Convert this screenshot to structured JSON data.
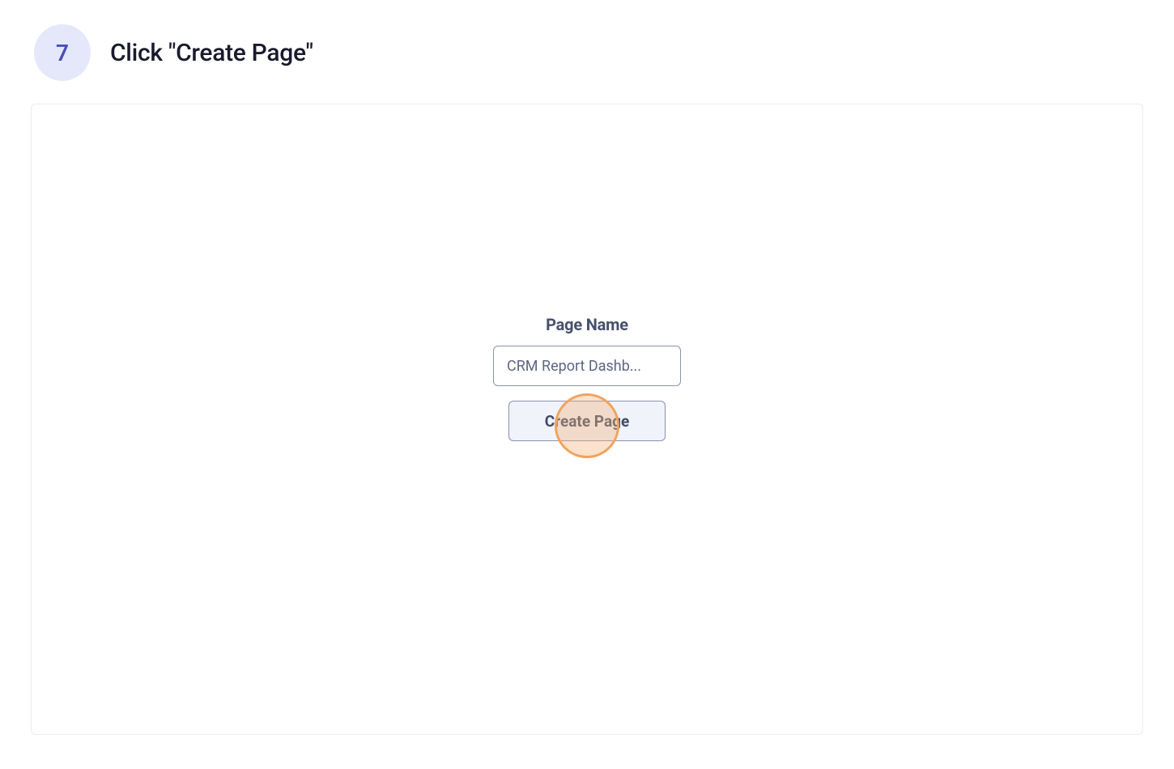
{
  "step": {
    "number": "7",
    "title": "Click \"Create Page\""
  },
  "form": {
    "page_name_label": "Page Name",
    "page_name_value": "CRM Report Dashb...",
    "create_button_label": "Create Page"
  }
}
